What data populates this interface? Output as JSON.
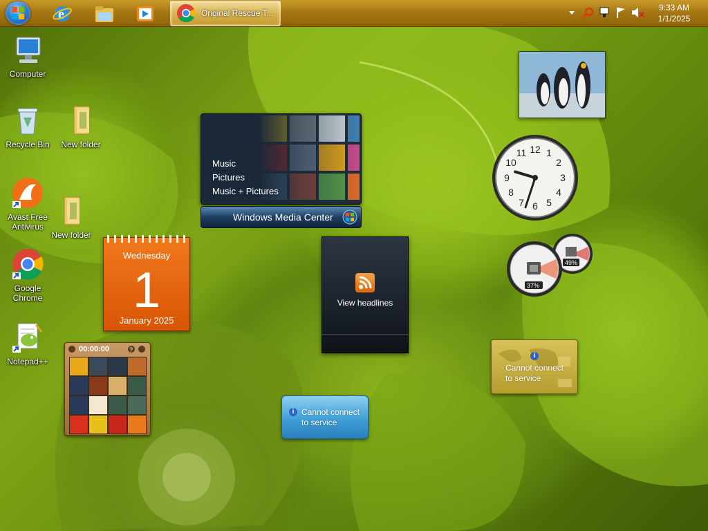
{
  "taskbar": {
    "start_button": "start-orb-icon",
    "pinned": [
      {
        "name": "Internet Explorer",
        "icon": "ie-icon"
      },
      {
        "name": "Windows Explorer",
        "icon": "folder-icon"
      },
      {
        "name": "Windows Media Player",
        "icon": "media-player-icon"
      }
    ],
    "active_task": {
      "label": "Original Rescue T...",
      "icon": "chrome-icon"
    },
    "tray_icons": [
      "chevron-up-icon",
      "search-icon",
      "network-icon",
      "action-center-flag-icon",
      "speaker-muted-icon"
    ],
    "clock": {
      "time": "9:33 AM",
      "date": "1/1/2025"
    }
  },
  "desktop_icons": [
    {
      "label": "Computer",
      "icon": "computer-icon"
    },
    {
      "label": "Recycle Bin",
      "icon": "recycle-bin-icon"
    },
    {
      "label": "New folder",
      "icon": "folder-icon"
    },
    {
      "label": "Avast Free Antivirus",
      "icon": "avast-icon"
    },
    {
      "label": "New folder",
      "icon": "folder-icon"
    },
    {
      "label": "Google Chrome",
      "icon": "chrome-icon"
    },
    {
      "label": "Notepad++",
      "icon": "notepad-plus-icon"
    }
  ],
  "gadgets": {
    "media_center": {
      "menu": [
        "Music",
        "Pictures",
        "Music + Pictures"
      ],
      "title": "Windows Media Center"
    },
    "calendar": {
      "weekday": "Wednesday",
      "day": "1",
      "month": "January 2025"
    },
    "feed_headlines": {
      "label": "View headlines"
    },
    "picture_puzzle": {
      "timer": "00:00:00"
    },
    "weather_blue": {
      "message_line1": "Cannot connect",
      "message_line2": "to service"
    },
    "weather_gold": {
      "message_line1": "Cannot connect",
      "message_line2": "to service"
    },
    "cpu_meter": {
      "cpu": "37%",
      "memory": "49%"
    },
    "clock_gadget": {
      "hour": 9,
      "minute": 33
    }
  },
  "colors": {
    "taskbar": "#a87814",
    "calendar": "#e0620e",
    "weather_blue": "#3f9fd6",
    "weather_gold": "#c8b046"
  }
}
